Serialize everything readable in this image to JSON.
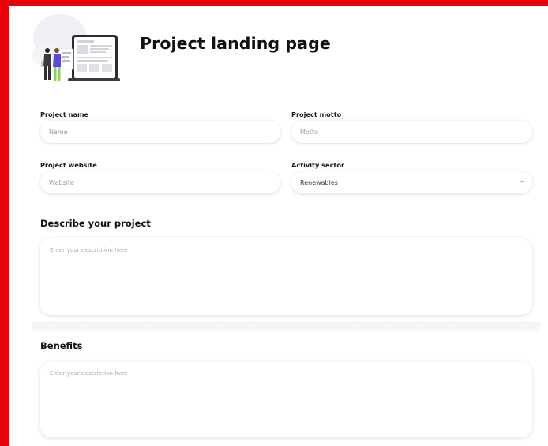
{
  "colors": {
    "frame": "#e8000a",
    "accent_purple": "#5a4bd0",
    "accent_green": "#8dd15f"
  },
  "header": {
    "title": "Project landing page",
    "illustration": "people-presenting-landing-page-illustration"
  },
  "form": {
    "project_name": {
      "label": "Project name",
      "placeholder": "Name"
    },
    "project_motto": {
      "label": "Project motto",
      "placeholder": "Motto"
    },
    "project_website": {
      "label": "Project website",
      "placeholder": "Website"
    },
    "activity_sector": {
      "label": "Activity sector",
      "value": "Renewables",
      "icon": "chevron-down-icon"
    },
    "describe": {
      "title": "Describe your project",
      "placeholder": "Enter your description here"
    },
    "benefits": {
      "title": "Benefits",
      "placeholder": "Enter your description here"
    }
  }
}
